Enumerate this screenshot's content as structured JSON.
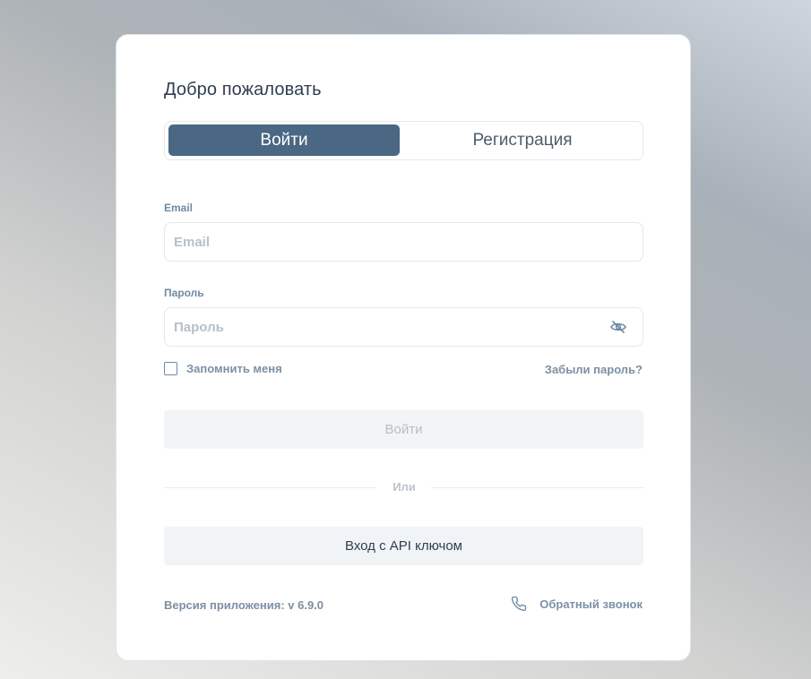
{
  "login": {
    "title": "Добро пожаловать",
    "tabs": [
      {
        "label": "Войти",
        "active": true
      },
      {
        "label": "Регистрация",
        "active": false
      }
    ],
    "email": {
      "label": "Email",
      "placeholder": "Email",
      "value": ""
    },
    "password": {
      "label": "Пароль",
      "placeholder": "Пароль",
      "value": "",
      "toggle_icon": "eye-off-icon"
    },
    "remember": {
      "label": "Запомнить меня",
      "checked": false
    },
    "forgot_label": "Забыли пароль?",
    "submit_label": "Войти",
    "divider_label": "Или",
    "api_key_label": "Вход с API ключом",
    "version_label": "Версия приложения: v 6.9.0",
    "callback": {
      "label": "Обратный звонок",
      "icon": "phone-icon"
    }
  },
  "colors": {
    "accent": "#4a6783",
    "muted_text": "#7c90a4",
    "title_text": "#2f3e4f",
    "disabled_button_bg": "#f3f4f6"
  }
}
